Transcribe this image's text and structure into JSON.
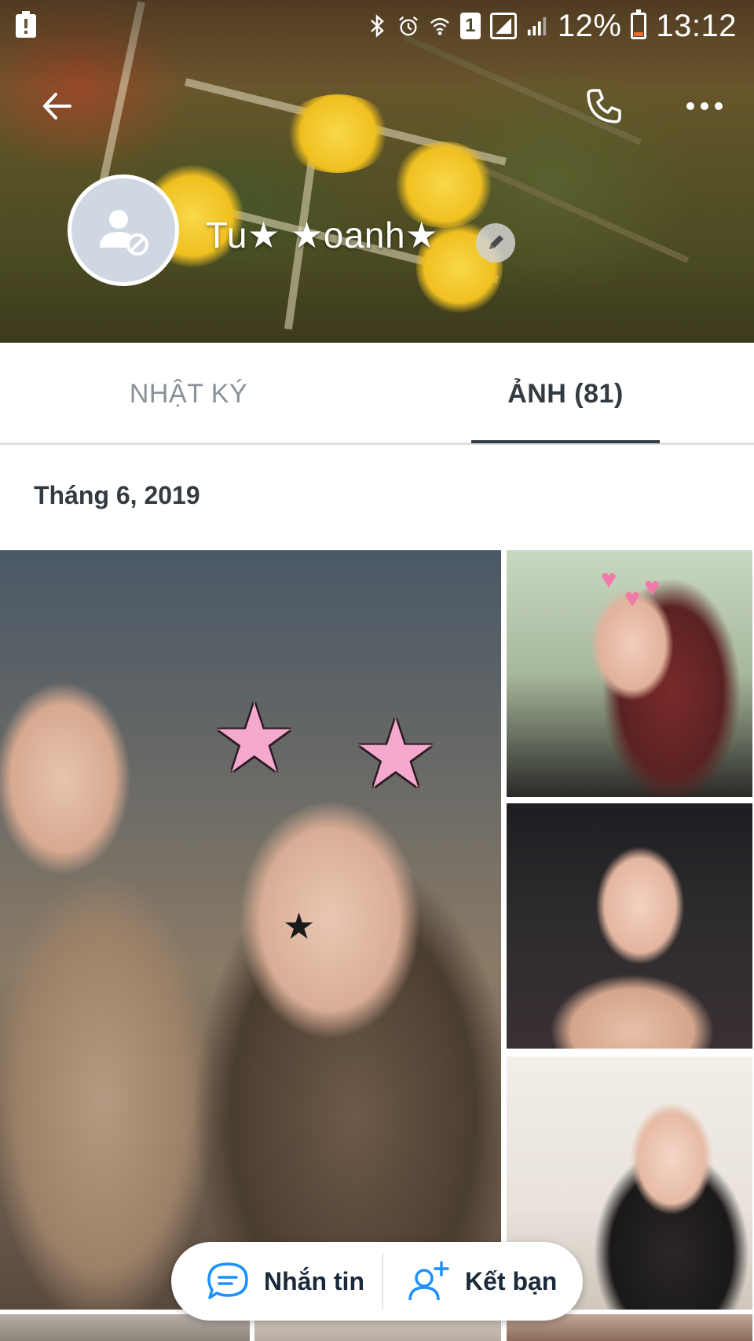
{
  "status_bar": {
    "battery_percent": "12%",
    "time": "13:12",
    "sim_slot": "1",
    "icons": [
      "alert-icon",
      "bluetooth-icon",
      "alarm-icon",
      "wifi-icon",
      "sim-icon",
      "signal-icon",
      "battery-icon"
    ]
  },
  "header": {
    "icons": [
      "back-arrow-icon",
      "phone-icon",
      "more-icon"
    ]
  },
  "profile": {
    "name": "Tu★ ★oanh★",
    "avatar_icon": "user-blocked-icon",
    "edit_icon": "pencil-icon"
  },
  "tabs": [
    {
      "label": "NHẬT KÝ",
      "active": false
    },
    {
      "label": "ẢNH (81)",
      "active": true
    }
  ],
  "gallery": {
    "date_label": "Tháng 6, 2019"
  },
  "action_bar": {
    "message_label": "Nhắn tin",
    "add_friend_label": "Kết bạn",
    "message_icon": "chat-bubble-icon",
    "add_friend_icon": "add-user-icon"
  },
  "colors": {
    "accent_blue": "#1e90ff",
    "active_tab": "#333a40",
    "inactive_tab": "#8a9199"
  }
}
